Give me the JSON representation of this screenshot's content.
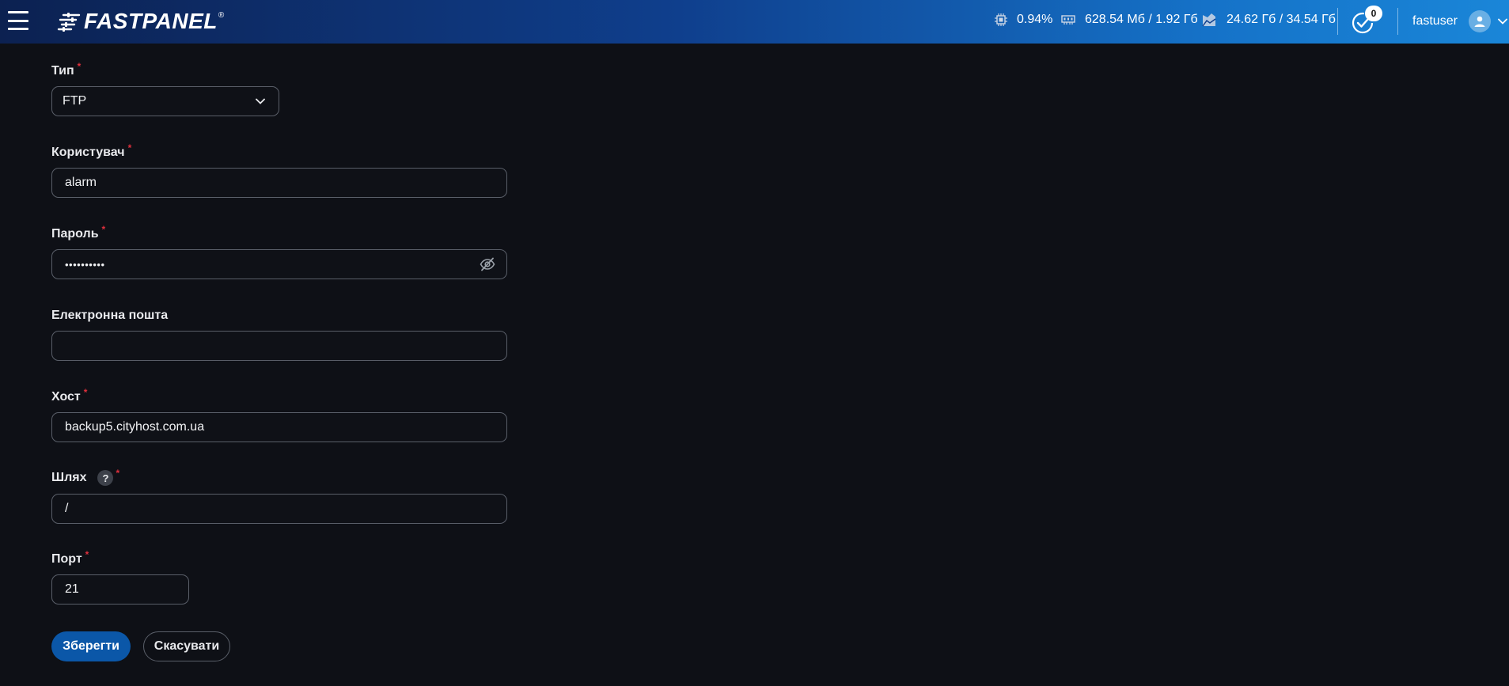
{
  "header": {
    "logo_text": "FASTPANEL",
    "logo_reg": "®",
    "cpu": "0.94%",
    "ram": "628.54 Мб / 1.92 Гб",
    "disk": "24.62 Гб / 34.54 Гб",
    "tasks_count": "0",
    "username": "fastuser",
    "icons": [
      "menu-icon",
      "cpu-icon",
      "ram-icon",
      "disk-icon",
      "tasks-icon",
      "user-icon",
      "chevron-down-icon"
    ]
  },
  "form": {
    "type": {
      "label": "Тип",
      "value": "FTP"
    },
    "user": {
      "label": "Користувач",
      "value": "alarm"
    },
    "password": {
      "label": "Пароль",
      "value": "••••••••••"
    },
    "email": {
      "label": "Електронна пошта",
      "value": ""
    },
    "host": {
      "label": "Хост",
      "value": "backup5.cityhost.com.ua"
    },
    "path": {
      "label": "Шлях",
      "help": "?",
      "value": "/"
    },
    "port": {
      "label": "Порт",
      "value": "21"
    },
    "required_mark": "*",
    "save_label": "Зберегти",
    "cancel_label": "Скасувати"
  },
  "colors": {
    "background": "#0e1016",
    "primary": "#0b57a8",
    "required": "#e0303d",
    "border": "#5a5f69"
  }
}
